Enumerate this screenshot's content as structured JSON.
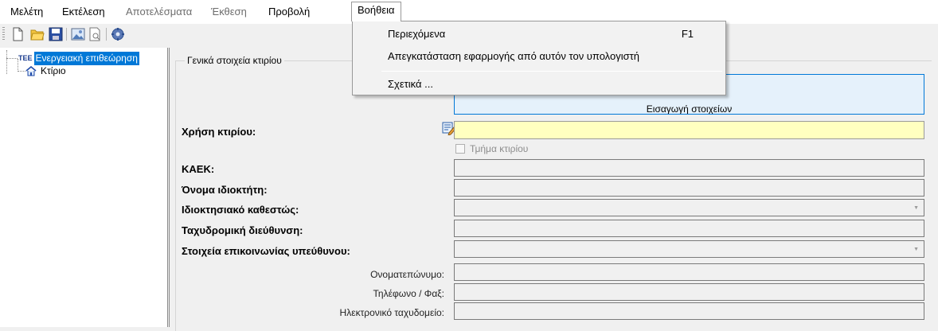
{
  "menubar": {
    "items": [
      {
        "label": "Μελέτη",
        "disabled": false
      },
      {
        "label": "Εκτέλεση",
        "disabled": false
      },
      {
        "label": "Αποτελέσματα",
        "disabled": true
      },
      {
        "label": "Έκθεση",
        "disabled": true
      },
      {
        "label": "Προβολή",
        "disabled": false
      },
      {
        "label": "Βοήθεια",
        "disabled": false,
        "open": true
      }
    ]
  },
  "help_menu": {
    "items": [
      {
        "label": "Περιεχόμενα",
        "shortcut": "F1"
      },
      {
        "label": "Απεγκατάσταση εφαρμογής από αυτόν τον υπολογιστή"
      },
      {
        "label": "Σχετικά ..."
      }
    ]
  },
  "toolbar": {
    "icons": [
      "new-file-icon",
      "open-folder-icon",
      "save-icon",
      "picture-icon",
      "print-preview-icon",
      "settings-gear-icon"
    ]
  },
  "tree": {
    "root_prefix": "ΤΕΕ",
    "root_label": "Ενεργειακή επιθεώρηση",
    "child_label": "Κτίριο"
  },
  "form": {
    "group_title": "Γενικά στοιχεία κτιρίου",
    "import_button": "Εισαγωγή στοιχείων",
    "usage_label": "Χρήση κτιρίου:",
    "usage_value": "",
    "part_checkbox_label": "Τμήμα κτιρίου",
    "part_checkbox_checked": false,
    "kaek_label": "ΚΑΕΚ:",
    "owner_label": "Όνομα ιδιοκτήτη:",
    "ownership_label": "Ιδιοκτησιακό καθεστώς:",
    "address_label": "Ταχυδρομική διεύθυνση:",
    "contact_label": "Στοιχεία επικοινωνίας υπεύθυνου:",
    "fullname_label": "Ονοματεπώνυμο:",
    "phone_label": "Τηλέφωνο / Φαξ:",
    "email_label": "Ηλεκτρονικό ταχυδομείο:"
  },
  "colors": {
    "selection": "#0078d7",
    "required_field": "#ffffc0",
    "button_highlight": "#e5f1fb"
  }
}
